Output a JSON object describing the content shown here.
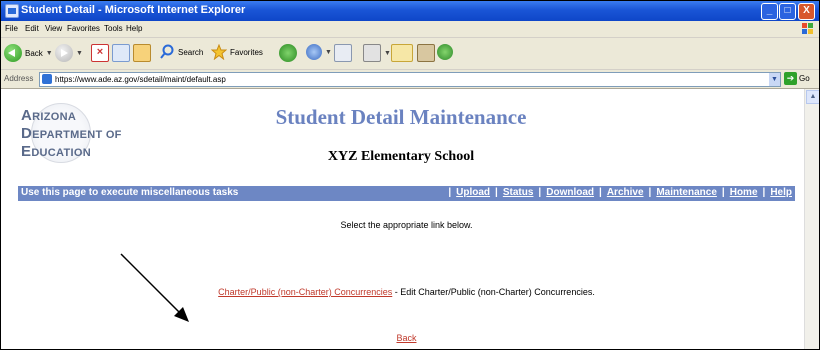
{
  "window": {
    "title": "Student Detail - Microsoft Internet Explorer",
    "minimize": "_",
    "maximize": "□",
    "close": "X"
  },
  "menu": [
    "File",
    "Edit",
    "View",
    "Favorites",
    "Tools",
    "Help"
  ],
  "toolbar": {
    "back_label": "Back",
    "search_label": "Search",
    "favorites_label": "Favorites"
  },
  "address": {
    "label": "Address",
    "url": "https://www.ade.az.gov/sdetail/maint/default.asp",
    "go_label": "Go"
  },
  "logo": {
    "line1_cap": "A",
    "line1_rest": "RIZONA",
    "line2_cap": "D",
    "line2_rest": "EPARTMENT OF",
    "line3_cap": "E",
    "line3_rest": "DUCATION"
  },
  "page": {
    "title": "Student Detail Maintenance",
    "school": "XYZ Elementary School",
    "nav_hint": "Use this page to execute miscellaneous tasks",
    "nav_links": [
      "Upload",
      "Status",
      "Download",
      "Archive",
      "Maintenance",
      "Home",
      "Help"
    ],
    "nav_separator": "|",
    "instruction": "Select the appropriate link below.",
    "concurrency_link": "Charter/Public (non-Charter) Concurrencies",
    "concurrency_desc": " - Edit Charter/Public (non-Charter) Concurrencies.",
    "back_link": "Back"
  },
  "colors": {
    "titlebar": "#1a55d6",
    "nav_bar": "#6d87c4",
    "page_title": "#6a82c0",
    "link": "#c0392b"
  },
  "icons": [
    "back-icon",
    "forward-icon",
    "stop-icon",
    "refresh-icon",
    "home-icon",
    "search-icon",
    "favorites-star-icon",
    "media-icon",
    "history-icon",
    "mail-icon",
    "print-icon",
    "edit-icon",
    "folder-icon",
    "research-icon",
    "messenger-icon",
    "windows-logo-icon",
    "ie-page-icon",
    "go-arrow-icon",
    "arrow-annotation-icon"
  ]
}
